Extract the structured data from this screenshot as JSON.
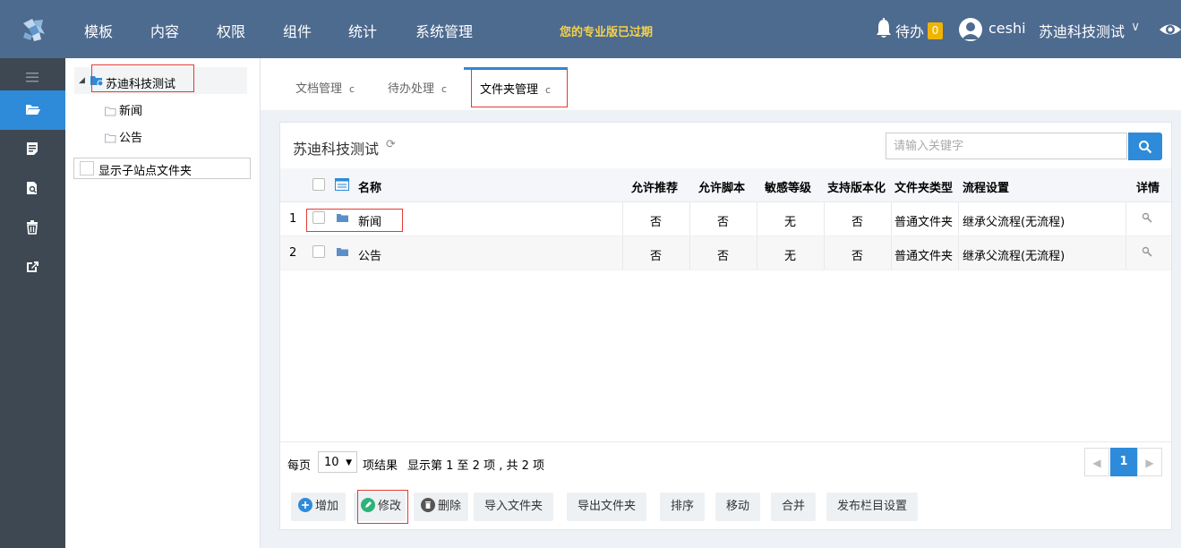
{
  "topbar": {
    "nav": [
      "模板",
      "内容",
      "权限",
      "组件",
      "统计",
      "系统管理"
    ],
    "notice": "您的专业版已过期",
    "todo_label": "待办",
    "todo_count": "0",
    "user_name": "ceshi",
    "company": "苏迪科技测试",
    "company_caret": "∨"
  },
  "tree": {
    "toggle": "◢",
    "root": "苏迪科技测试",
    "children": [
      "新闻",
      "公告"
    ],
    "show_subsite": "显示子站点文件夹"
  },
  "tabs": [
    {
      "label": "文档管理",
      "refresh": "c"
    },
    {
      "label": "待办处理",
      "refresh": "c"
    },
    {
      "label": "文件夹管理",
      "refresh": "c"
    }
  ],
  "panel": {
    "title": "苏迪科技测试",
    "title_refresh": "⟳",
    "search_placeholder": "请输入关键字"
  },
  "table": {
    "headers": {
      "name": "名称",
      "recommend": "允许推荐",
      "script": "允许脚本",
      "sensitivity": "敏感等级",
      "versioning": "支持版本化",
      "folder_type": "文件夹类型",
      "workflow": "流程设置",
      "detail": "详情"
    },
    "rows": [
      {
        "index": "1",
        "name": "新闻",
        "recommend": "否",
        "script": "否",
        "sensitivity": "无",
        "versioning": "否",
        "folder_type": "普通文件夹",
        "workflow": "继承父流程(无流程)"
      },
      {
        "index": "2",
        "name": "公告",
        "recommend": "否",
        "script": "否",
        "sensitivity": "无",
        "versioning": "否",
        "folder_type": "普通文件夹",
        "workflow": "继承父流程(无流程)"
      }
    ]
  },
  "pager": {
    "per_page": "每页",
    "page_size": "10",
    "page_size_caret": "▼",
    "items_result": "项结果",
    "showing": "显示第 1 至 2 项 , 共 2 项",
    "prev": "◀",
    "current": "1",
    "next": "▶"
  },
  "actions": {
    "add": "增加",
    "edit": "修改",
    "delete": "删除",
    "import": "导入文件夹",
    "export": "导出文件夹",
    "sort": "排序",
    "move": "移动",
    "merge": "合并",
    "publish": "发布栏目设置"
  },
  "colors": {
    "topbar": "#4d6a8f",
    "sidebar": "#3d4852",
    "accent": "#2e8bd9",
    "notice": "#f5d24a",
    "badge": "#f0b400",
    "highlight": "#e53935"
  }
}
